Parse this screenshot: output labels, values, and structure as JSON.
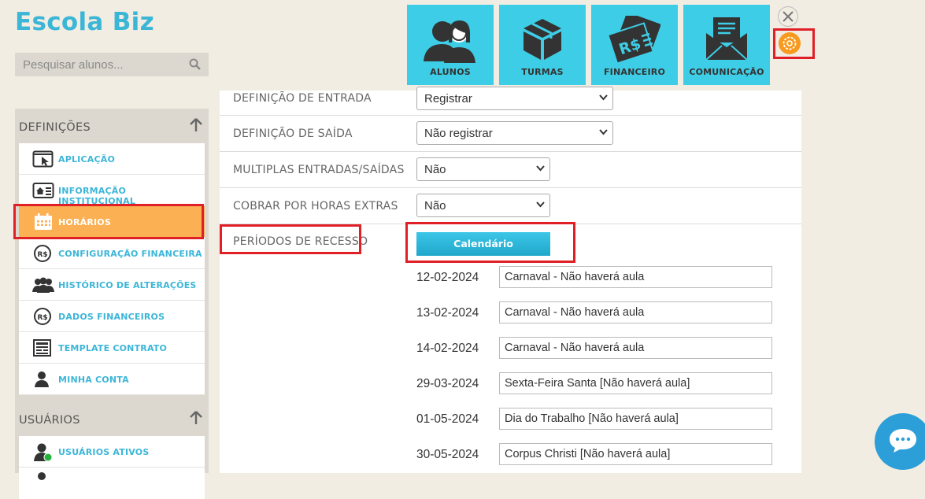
{
  "app": {
    "title": "Escola Biz"
  },
  "search": {
    "placeholder": "Pesquisar alunos..."
  },
  "top_nav": [
    {
      "label": "ALUNOS",
      "icon": "students-icon"
    },
    {
      "label": "TURMAS",
      "icon": "box-icon"
    },
    {
      "label": "FINANCEIRO",
      "icon": "money-icon"
    },
    {
      "label": "COMUNICAÇÃO",
      "icon": "mail-icon"
    }
  ],
  "sidebar": {
    "sections": [
      {
        "title": "DEFINIÇÕES",
        "items": [
          {
            "label": "APLICAÇÃO",
            "icon": "cursor-window-icon"
          },
          {
            "label": "INFORMAÇÃO INSTITUCIONAL",
            "icon": "institution-card-icon"
          },
          {
            "label": "HORÁRIOS",
            "icon": "calendar-icon",
            "active": true
          },
          {
            "label": "CONFIGURAÇÃO FINANCEIRA",
            "icon": "currency-icon"
          },
          {
            "label": "HISTÓRICO DE ALTERAÇÕES",
            "icon": "group-icon"
          },
          {
            "label": "DADOS FINANCEIROS",
            "icon": "currency-icon"
          },
          {
            "label": "TEMPLATE CONTRATO",
            "icon": "document-icon"
          },
          {
            "label": "MINHA CONTA",
            "icon": "user-icon"
          }
        ]
      },
      {
        "title": "USUÁRIOS",
        "items": [
          {
            "label": "USUÁRIOS ATIVOS",
            "icon": "active-user-icon"
          }
        ]
      }
    ]
  },
  "form": {
    "rows": [
      {
        "label": "DEFINIÇÃO DE ENTRADA",
        "value": "Registrar"
      },
      {
        "label": "DEFINIÇÃO DE SAÍDA",
        "value": "Não registrar"
      },
      {
        "label": "MULTIPLAS ENTRADAS/SAÍDAS",
        "value": "Não"
      },
      {
        "label": "COBRAR POR HORAS EXTRAS",
        "value": "Não"
      }
    ],
    "recess": {
      "label": "PERÍODOS DE RECESSO",
      "button": "Calendário",
      "holidays": [
        {
          "date": "12-02-2024",
          "desc": "Carnaval - Não haverá aula"
        },
        {
          "date": "13-02-2024",
          "desc": "Carnaval - Não haverá aula"
        },
        {
          "date": "14-02-2024",
          "desc": "Carnaval - Não haverá aula"
        },
        {
          "date": "29-03-2024",
          "desc": "Sexta-Feira Santa [Não haverá aula]"
        },
        {
          "date": "01-05-2024",
          "desc": "Dia do Trabalho [Não haverá aula]"
        },
        {
          "date": "30-05-2024",
          "desc": "Corpus Christi [Não haverá aula]"
        }
      ]
    }
  },
  "colors": {
    "accent": "#3bb6d6",
    "tile": "#3ecde6",
    "active": "#fcb054",
    "highlight": "#e01f26",
    "gear": "#f79a1e"
  }
}
